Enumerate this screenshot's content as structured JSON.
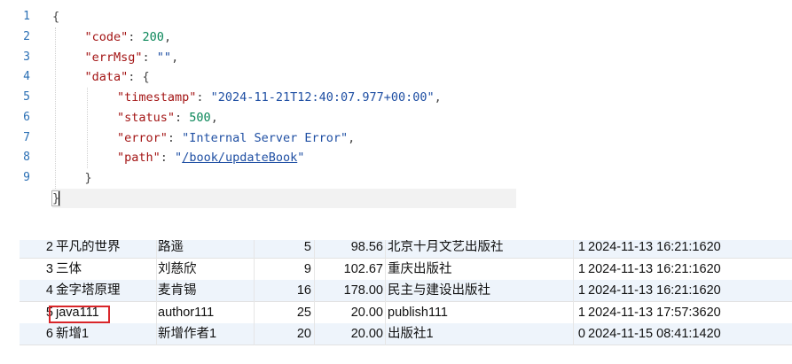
{
  "editor": {
    "line_numbers": [
      "1",
      "2",
      "3",
      "4",
      "5",
      "6",
      "7",
      "8",
      "9"
    ],
    "lines": [
      {
        "indent": 0,
        "open": "{"
      },
      {
        "indent": 1,
        "key": "\"code\"",
        "colon": ": ",
        "num": "200",
        "tail": ","
      },
      {
        "indent": 1,
        "key": "\"errMsg\"",
        "colon": ": ",
        "str": "\"\"",
        "tail": ","
      },
      {
        "indent": 1,
        "key": "\"data\"",
        "colon": ": ",
        "open": "{"
      },
      {
        "indent": 2,
        "key": "\"timestamp\"",
        "colon": ": ",
        "str": "\"2024-11-21T12:40:07.977+00:00\"",
        "tail": ","
      },
      {
        "indent": 2,
        "key": "\"status\"",
        "colon": ": ",
        "num": "500",
        "tail": ","
      },
      {
        "indent": 2,
        "key": "\"error\"",
        "colon": ": ",
        "str": "\"Internal Server Error\"",
        "tail": ","
      },
      {
        "indent": 2,
        "key": "\"path\"",
        "colon": ": ",
        "link": "\"/book/updateBook\""
      },
      {
        "indent": 1,
        "close": "}"
      },
      {
        "indent": 0,
        "close": "}"
      }
    ],
    "colors": {
      "line_number": "#2a6fb4",
      "key": "#a31515",
      "string": "#1f4fa3",
      "number": "#098658"
    }
  },
  "table": {
    "rows": [
      {
        "id": "2",
        "name": "平凡的世界",
        "author": "路遥",
        "qty": "5",
        "price": "98.56",
        "publisher": "北京十月文艺出版社",
        "flag": "1",
        "time": "2024-11-13 16:21:1620"
      },
      {
        "id": "3",
        "name": "三体",
        "author": "刘慈欣",
        "qty": "9",
        "price": "102.67",
        "publisher": "重庆出版社",
        "flag": "1",
        "time": "2024-11-13 16:21:1620"
      },
      {
        "id": "4",
        "name": "金字塔原理",
        "author": "麦肯锡",
        "qty": "16",
        "price": "178.00",
        "publisher": "民主与建设出版社",
        "flag": "1",
        "time": "2024-11-13 16:21:1620"
      },
      {
        "id": "5",
        "name": "java111",
        "author": "author111",
        "qty": "25",
        "price": "20.00",
        "publisher": "publish111",
        "flag": "1",
        "time": "2024-11-13 17:57:3620"
      },
      {
        "id": "6",
        "name": "新增1",
        "author": "新增作者1",
        "qty": "20",
        "price": "20.00",
        "publisher": "出版社1",
        "flag": "0",
        "time": "2024-11-15 08:41:1420"
      }
    ],
    "colors": {
      "alt_row": "#eef4fb",
      "highlight_box": "#d9262a"
    }
  }
}
